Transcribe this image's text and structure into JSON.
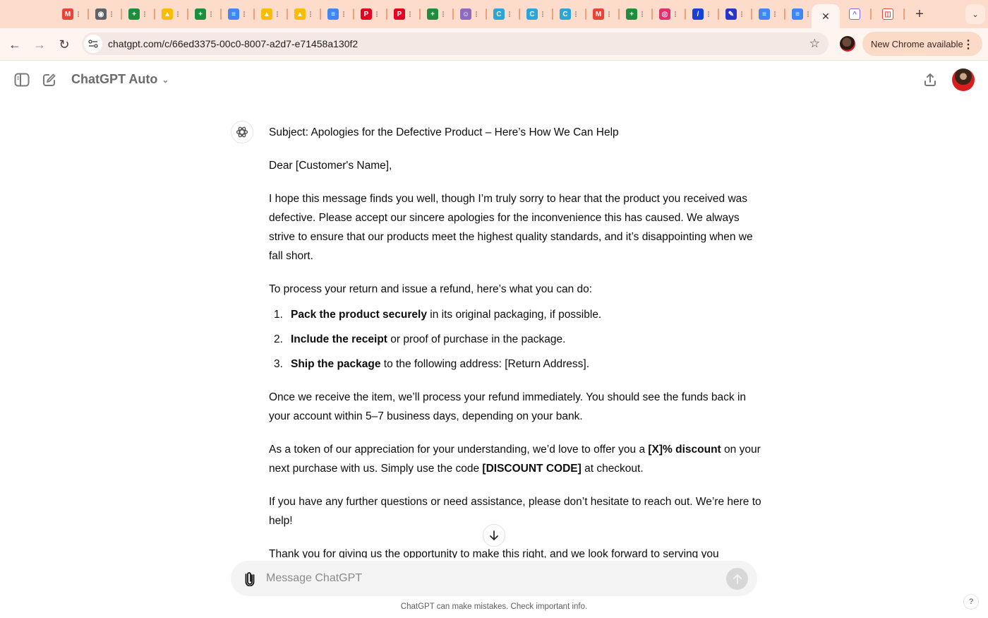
{
  "browser": {
    "tabs": [
      {
        "icon": "gmail-icon",
        "color": "#ea4335",
        "glyph": "M"
      },
      {
        "icon": "globe-icon",
        "color": "#5f6368",
        "glyph": "◉"
      },
      {
        "icon": "sheets-icon",
        "color": "#1e8e3e",
        "glyph": "+"
      },
      {
        "icon": "drive-icon",
        "color": "#fbbc04",
        "glyph": "▲"
      },
      {
        "icon": "sheets-icon",
        "color": "#1e8e3e",
        "glyph": "+"
      },
      {
        "icon": "docs-icon",
        "color": "#4285f4",
        "glyph": "≡"
      },
      {
        "icon": "drive-icon",
        "color": "#fbbc04",
        "glyph": "▲"
      },
      {
        "icon": "drive-icon",
        "color": "#fbbc04",
        "glyph": "▲"
      },
      {
        "icon": "docs-icon",
        "color": "#4285f4",
        "glyph": "≡"
      },
      {
        "icon": "pinterest-icon",
        "color": "#e60023",
        "glyph": "P"
      },
      {
        "icon": "pinterest-icon",
        "color": "#e60023",
        "glyph": "P"
      },
      {
        "icon": "sheets-icon",
        "color": "#1e8e3e",
        "glyph": "+"
      },
      {
        "icon": "avatar-icon",
        "color": "#8e6bbf",
        "glyph": "☺"
      },
      {
        "icon": "canva-icon",
        "color": "#2aa6d8",
        "glyph": "C"
      },
      {
        "icon": "canva-icon",
        "color": "#2aa6d8",
        "glyph": "C"
      },
      {
        "icon": "canva-icon",
        "color": "#2aa6d8",
        "glyph": "C"
      },
      {
        "icon": "gmail-icon",
        "color": "#ea4335",
        "glyph": "M"
      },
      {
        "icon": "sheets-icon",
        "color": "#1e8e3e",
        "glyph": "+"
      },
      {
        "icon": "instagram-icon",
        "color": "#e1306c",
        "glyph": "◎"
      },
      {
        "icon": "quill-icon",
        "color": "#1a3fd6",
        "glyph": "/"
      },
      {
        "icon": "quill-icon",
        "color": "#2a35c8",
        "glyph": "✎"
      },
      {
        "icon": "docs-icon",
        "color": "#4285f4",
        "glyph": "≡"
      },
      {
        "icon": "docs-icon",
        "color": "#4285f4",
        "glyph": "≡"
      }
    ],
    "active_tab_close": "✕",
    "after_tabs": [
      {
        "icon": "clickup-icon",
        "color": "#7b68ee",
        "glyph": "^"
      },
      {
        "icon": "chart-app-icon",
        "color": "#e8453c",
        "glyph": "◫"
      }
    ],
    "new_tab": "+",
    "tab_search": "⌄",
    "url": "chatgpt.com/c/66ed3375-00c0-8007-a2d7-e71458a130f2",
    "update_label": "New Chrome available"
  },
  "header": {
    "model_label": "ChatGPT Auto"
  },
  "message": {
    "subject": "Subject: Apologies for the Defective Product – Here’s How We Can Help",
    "greeting": "Dear [Customer's Name],",
    "para1": "I hope this message finds you well, though I’m truly sorry to hear that the product you received was defective. Please accept our sincere apologies for the inconvenience this has caused. We always strive to ensure that our products meet the highest quality standards, and it’s disappointing when we fall short.",
    "para2": "To process your return and issue a refund, here’s what you can do:",
    "steps": [
      {
        "num": "1.",
        "bold": "Pack the product securely",
        "rest": " in its original packaging, if possible."
      },
      {
        "num": "2.",
        "bold": "Include the receipt",
        "rest": " or proof of purchase in the package."
      },
      {
        "num": "3.",
        "bold": "Ship the package",
        "rest": " to the following address: [Return Address]."
      }
    ],
    "para3": "Once we receive the item, we’ll process your refund immediately. You should see the funds back in your account within 5–7 business days, depending on your bank.",
    "para4": {
      "a": "As a token of our appreciation for your understanding, we’d love to offer you a ",
      "b": "[X]% discount",
      "c": " on your next purchase with us. Simply use the code ",
      "d": "[DISCOUNT CODE]",
      "e": " at checkout."
    },
    "para5": "If you have any further questions or need assistance, please don’t hesitate to reach out. We’re here to help!",
    "para6": "Thank you for giving us the opportunity to make this right, and we look forward to serving you"
  },
  "composer": {
    "placeholder": "Message ChatGPT",
    "value": ""
  },
  "footer": {
    "disclaimer": "ChatGPT can make mistakes. Check important info.",
    "help": "?"
  }
}
